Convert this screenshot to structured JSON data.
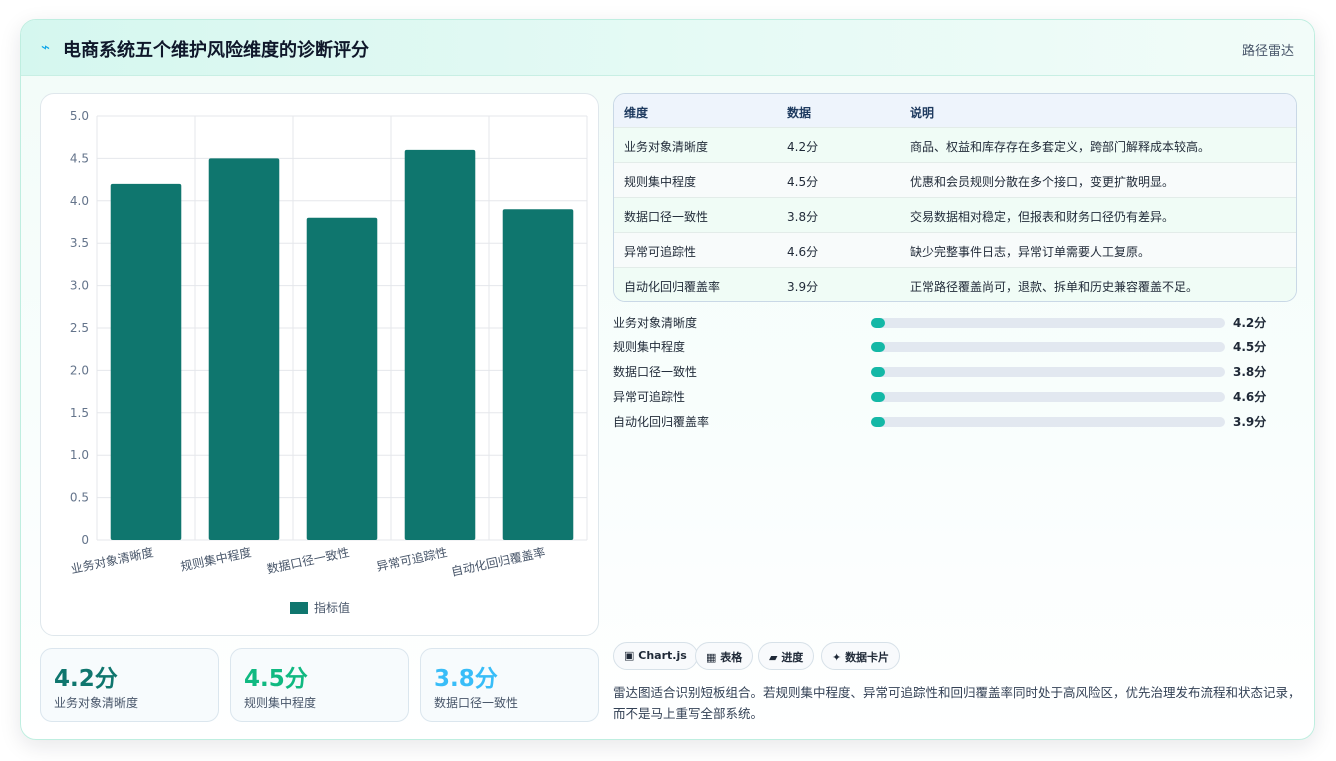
{
  "header": {
    "title": "电商系统五个维护风险维度的诊断评分",
    "tag": "路径雷达",
    "icon": "bolt-icon"
  },
  "chart_data": {
    "type": "bar",
    "categories": [
      "业务对象清晰度",
      "规则集中程度",
      "数据口径一致性",
      "异常可追踪性",
      "自动化回归覆盖率"
    ],
    "series": [
      {
        "name": "指标值",
        "values": [
          4.2,
          4.5,
          3.8,
          4.6,
          3.9
        ]
      }
    ],
    "ylim": [
      0,
      5
    ],
    "yticks": [
      "0",
      "0.5",
      "1.0",
      "1.5",
      "2.0",
      "2.5",
      "3.0",
      "3.5",
      "4.0",
      "4.5",
      "5.0"
    ],
    "grid": true,
    "legend": "bottom",
    "bar_color": "#0f766e"
  },
  "metrics": [
    {
      "value": "4.2分",
      "label": "业务对象清晰度",
      "color": "#0f766e"
    },
    {
      "value": "4.5分",
      "label": "规则集中程度",
      "color": "#10b981"
    },
    {
      "value": "3.8分",
      "label": "数据口径一致性",
      "color": "#38bdf8"
    }
  ],
  "table": {
    "headers": [
      "维度",
      "数据",
      "说明"
    ],
    "rows": [
      {
        "dim": "业务对象清晰度",
        "data": "4.2分",
        "desc": "商品、权益和库存存在多套定义，跨部门解释成本较高。"
      },
      {
        "dim": "规则集中程度",
        "data": "4.5分",
        "desc": "优惠和会员规则分散在多个接口，变更扩散明显。"
      },
      {
        "dim": "数据口径一致性",
        "data": "3.8分",
        "desc": "交易数据相对稳定，但报表和财务口径仍有差异。"
      },
      {
        "dim": "异常可追踪性",
        "data": "4.6分",
        "desc": "缺少完整事件日志，异常订单需要人工复原。"
      },
      {
        "dim": "自动化回归覆盖率",
        "data": "3.9分",
        "desc": "正常路径覆盖尚可，退款、拆单和历史兼容覆盖不足。"
      }
    ]
  },
  "progress": [
    {
      "label": "业务对象清晰度",
      "value": "4.2分"
    },
    {
      "label": "规则集中程度",
      "value": "4.5分"
    },
    {
      "label": "数据口径一致性",
      "value": "3.8分"
    },
    {
      "label": "异常可追踪性",
      "value": "4.6分"
    },
    {
      "label": "自动化回归覆盖率",
      "value": "3.9分"
    }
  ],
  "chips": [
    {
      "icon": "chart-icon",
      "glyph": "▣",
      "label": "Chart.js"
    },
    {
      "icon": "table-icon",
      "glyph": "▦",
      "label": "表格"
    },
    {
      "icon": "folder-icon",
      "glyph": "▰",
      "label": "进度"
    },
    {
      "icon": "sparkle-icon",
      "glyph": "✦",
      "label": "数据卡片"
    }
  ],
  "note": "雷达图适合识别短板组合。若规则集中程度、异常可追踪性和回归覆盖率同时处于高风险区，优先治理发布流程和状态记录，而不是马上重写全部系统。"
}
